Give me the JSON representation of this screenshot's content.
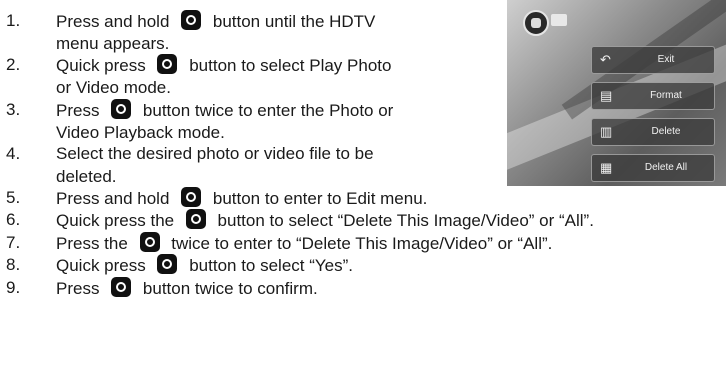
{
  "steps": [
    {
      "num": "1.",
      "lines": [
        [
          "Press and hold ",
          "camera-button-icon",
          " button until the HDTV"
        ],
        [
          "menu appears."
        ]
      ]
    },
    {
      "num": "2.",
      "lines": [
        [
          "Quick press ",
          "camera-button-icon",
          " button to select Play Photo"
        ],
        [
          "or Video mode."
        ]
      ]
    },
    {
      "num": "3.",
      "lines": [
        [
          "Press ",
          "camera-button-icon",
          " button twice to enter the Photo or"
        ],
        [
          "Video Playback mode."
        ]
      ]
    },
    {
      "num": "4.",
      "lines": [
        [
          "Select the desired photo or video file to be"
        ],
        [
          "deleted."
        ]
      ]
    },
    {
      "num": "5.",
      "lines": [
        [
          "Press and hold ",
          "camera-button-icon",
          " button to enter to Edit menu."
        ]
      ]
    },
    {
      "num": "6.",
      "lines": [
        [
          "Quick press the ",
          "camera-button-icon",
          " button to select “Delete This Image/Video” or “All”."
        ]
      ]
    },
    {
      "num": "7.",
      "lines": [
        [
          "Press the ",
          "camera-button-icon",
          " twice to enter to “Delete This Image/Video” or “All”."
        ]
      ]
    },
    {
      "num": "8.",
      "lines": [
        [
          "Quick press ",
          "camera-button-icon",
          " button to select “Yes”."
        ]
      ]
    },
    {
      "num": "9.",
      "lines": [
        [
          "Press ",
          "camera-button-icon",
          " button twice to confirm."
        ]
      ]
    }
  ],
  "screenshot": {
    "menu_items": [
      {
        "icon": "back-arrow-icon",
        "label": "Exit"
      },
      {
        "icon": "format-icon",
        "label": "Format"
      },
      {
        "icon": "trash-icon",
        "label": "Delete"
      },
      {
        "icon": "delete-all-icon",
        "label": "Delete All"
      }
    ]
  }
}
